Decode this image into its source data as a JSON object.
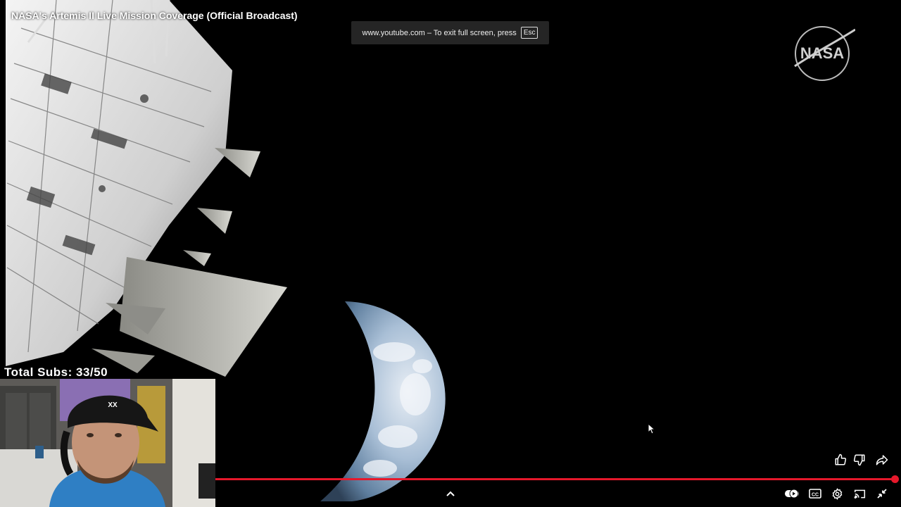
{
  "video": {
    "title": "NASA's Artemis II Live Mission Coverage (Official Broadcast)",
    "progress_fraction": 0.994
  },
  "fullscreen_notice": {
    "text": "www.youtube.com – To exit full screen, press",
    "key": "Esc"
  },
  "overlay": {
    "subs_label": "Total Subs: 33/50",
    "logo_text": "NASA"
  },
  "controls": {
    "like_icon": "thumbs-up-icon",
    "dislike_icon": "thumbs-down-icon",
    "share_icon": "share-arrow-icon",
    "expand_icon": "chevron-up-icon",
    "autoplay_icon": "toggle-icon",
    "captions_label": "CC",
    "settings_icon": "gear-icon",
    "cast_icon": "cast-icon",
    "exit_fullscreen_icon": "exit-fullscreen-icon"
  },
  "colors": {
    "progress": "#e6182b",
    "notice_bg": "#282828"
  }
}
